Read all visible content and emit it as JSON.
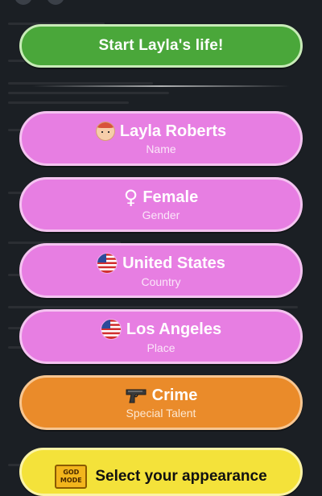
{
  "start_button": {
    "label": "Start Layla's life!"
  },
  "fields": [
    {
      "key": "name",
      "value": "Layla Roberts",
      "caption": "Name",
      "icon": "woman-face-icon"
    },
    {
      "key": "gender",
      "value": "Female",
      "caption": "Gender",
      "icon": "female-symbol-icon",
      "glyph": "♀"
    },
    {
      "key": "country",
      "value": "United States",
      "caption": "Country",
      "icon": "us-flag-icon"
    },
    {
      "key": "place",
      "value": "Los Angeles",
      "caption": "Place",
      "icon": "us-flag-icon"
    }
  ],
  "talent": {
    "value": "Crime",
    "caption": "Special Talent",
    "icon": "pistol-icon"
  },
  "appearance_button": {
    "label": "Select your appearance",
    "badge_line1": "GOD",
    "badge_line2": "MODE"
  },
  "colors": {
    "start_green": "#4aa73a",
    "field_pink": "#e77ee2",
    "talent_orange": "#ea8b2a",
    "appearance_yellow": "#f4e23a",
    "background": "#1b1f24"
  }
}
